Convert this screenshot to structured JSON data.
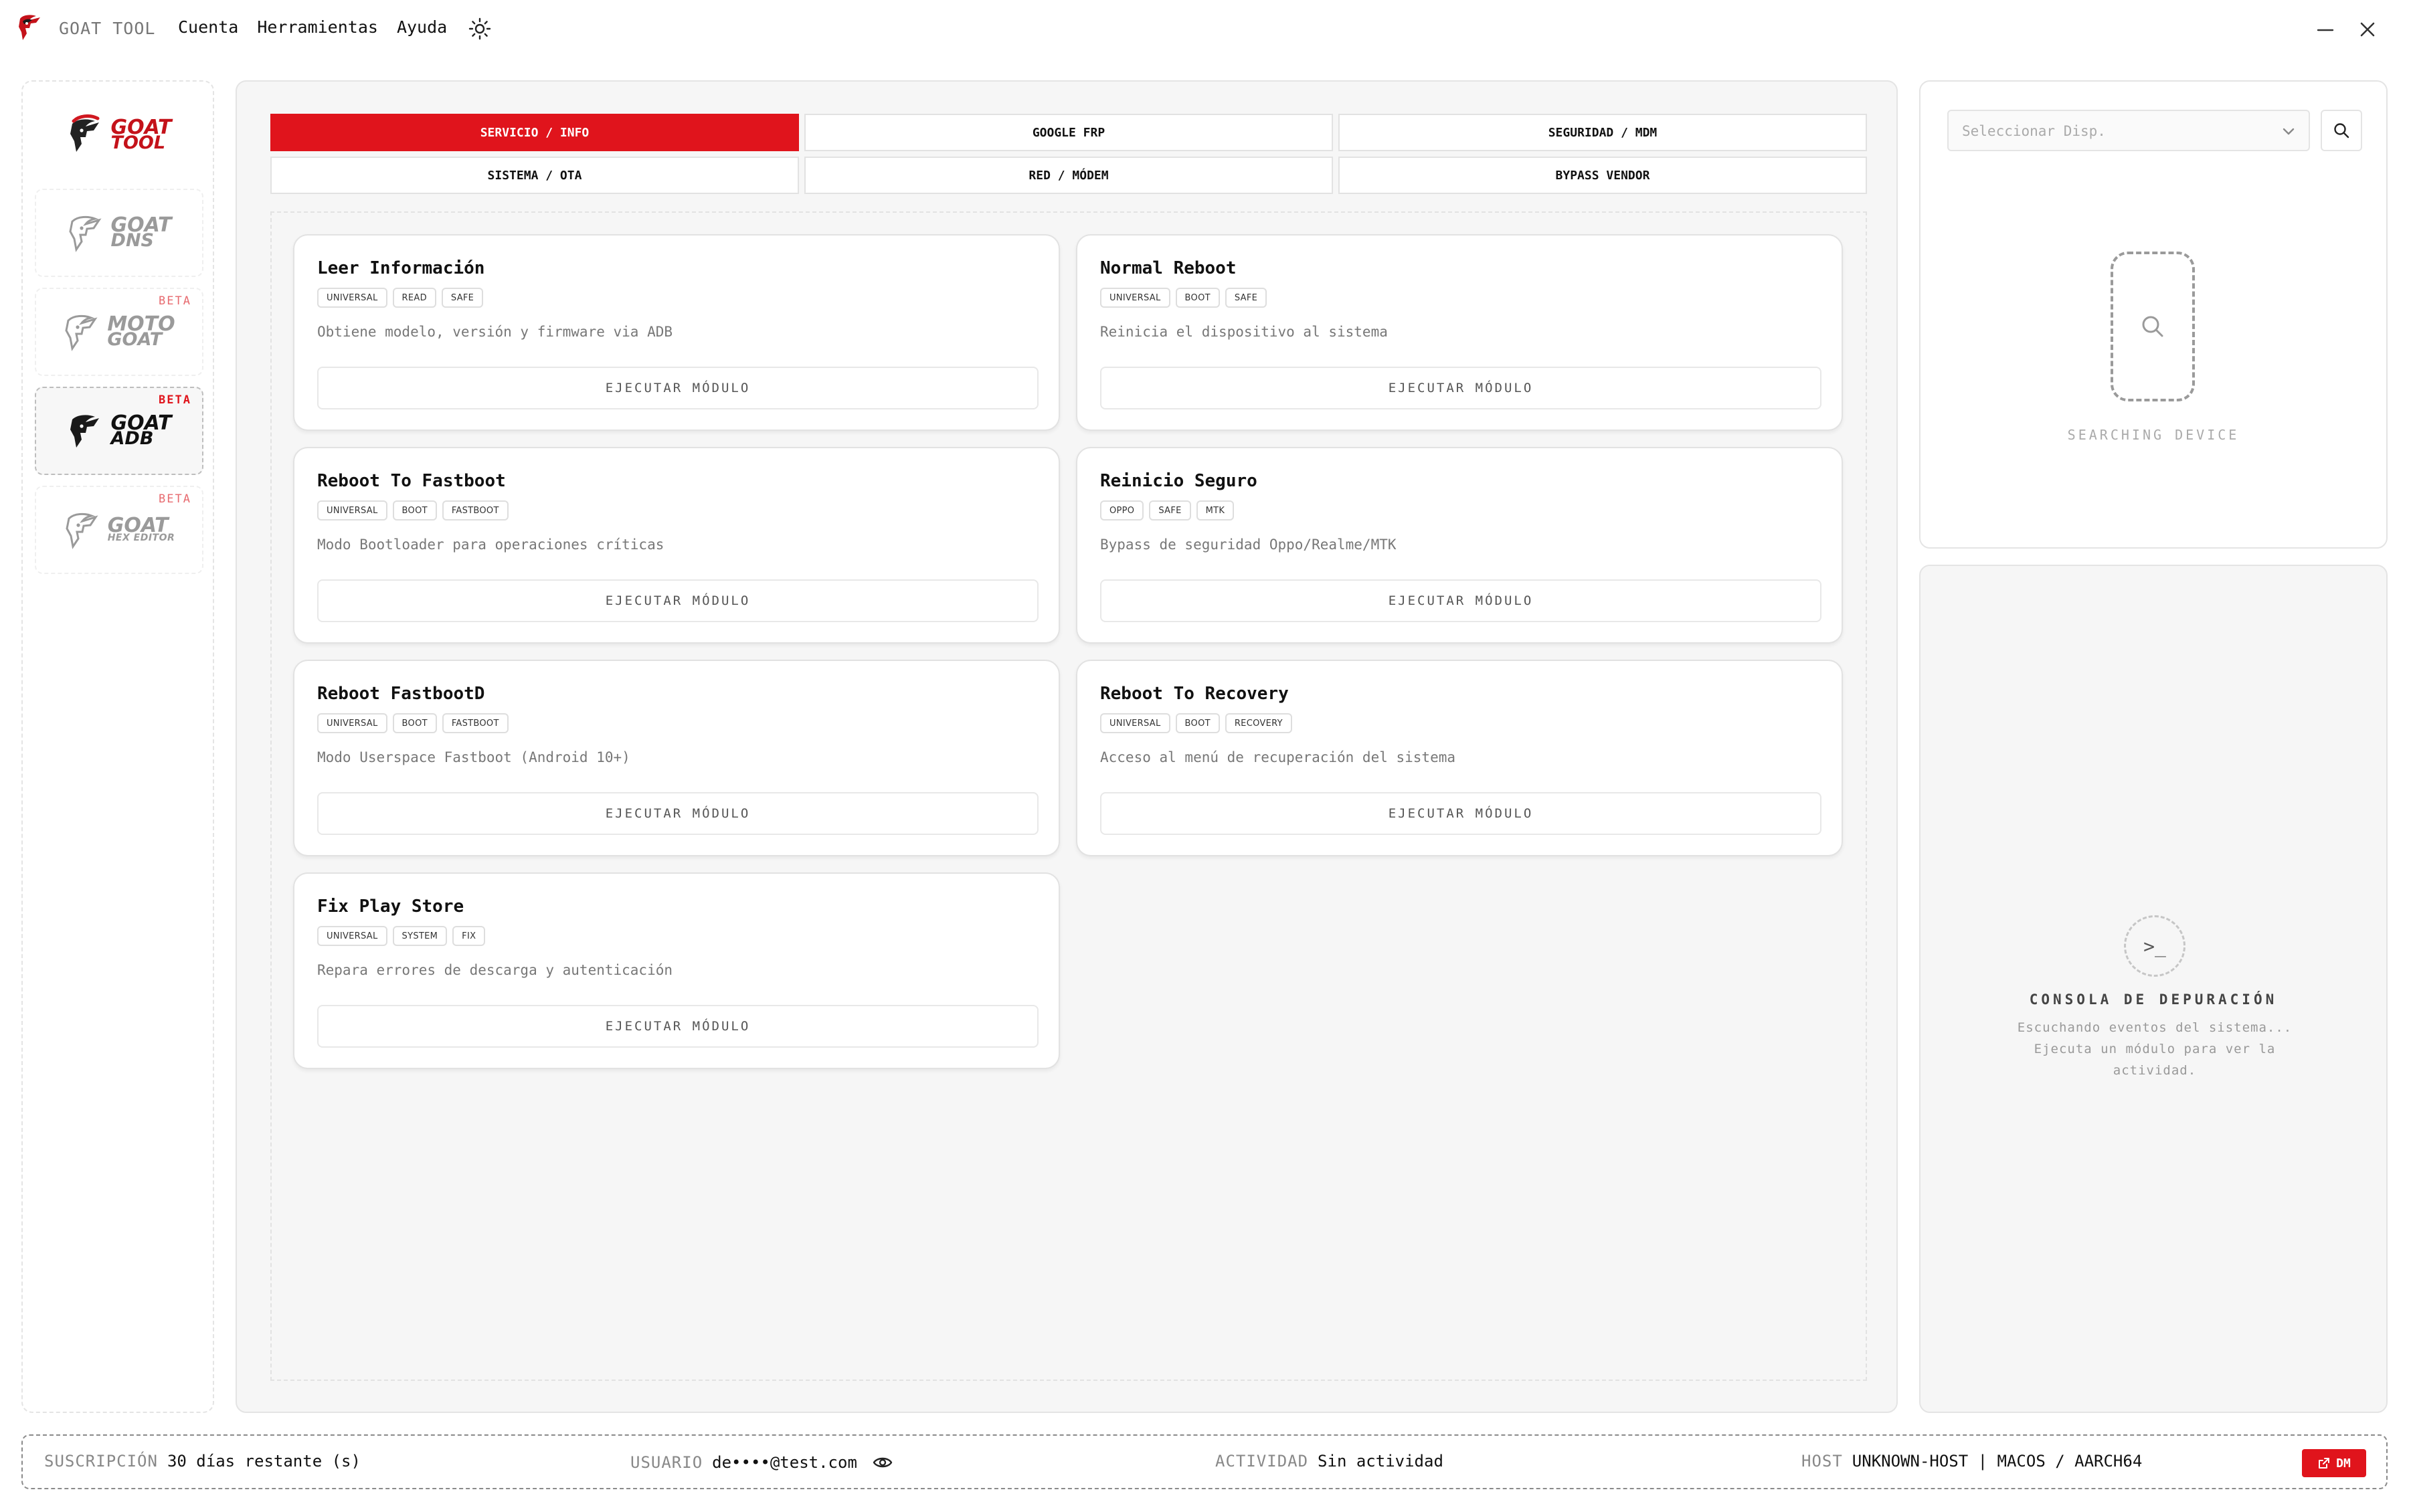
{
  "app": {
    "title": "GOAT TOOL",
    "menu": [
      "Cuenta",
      "Herramientas",
      "Ayuda"
    ]
  },
  "rail": {
    "items": [
      {
        "line1": "GOAT",
        "line2": "TOOL",
        "beta": ""
      },
      {
        "line1": "GOAT",
        "line2": "DNS",
        "beta": ""
      },
      {
        "line1": "MOTO",
        "line2": "GOAT",
        "beta": "BETA"
      },
      {
        "line1": "GOAT",
        "line2": "ADB",
        "beta": "BETA"
      },
      {
        "line1": "GOAT",
        "line2": "HEX EDITOR",
        "beta": "BETA"
      }
    ]
  },
  "tabs": [
    "SERVICIO / INFO",
    "GOOGLE FRP",
    "SEGURIDAD / MDM",
    "SISTEMA / OTA",
    "RED / MÓDEM",
    "BYPASS VENDOR"
  ],
  "run_label": "EJECUTAR MÓDULO",
  "modules": [
    {
      "title": "Leer Información",
      "tags": [
        "UNIVERSAL",
        "READ",
        "SAFE"
      ],
      "desc": "Obtiene modelo, versión y firmware via ADB"
    },
    {
      "title": "Normal Reboot",
      "tags": [
        "UNIVERSAL",
        "BOOT",
        "SAFE"
      ],
      "desc": "Reinicia el dispositivo al sistema"
    },
    {
      "title": "Reboot To Fastboot",
      "tags": [
        "UNIVERSAL",
        "BOOT",
        "FASTBOOT"
      ],
      "desc": "Modo Bootloader para operaciones críticas"
    },
    {
      "title": "Reinicio Seguro",
      "tags": [
        "OPPO",
        "SAFE",
        "MTK"
      ],
      "desc": "Bypass de seguridad Oppo/Realme/MTK"
    },
    {
      "title": "Reboot FastbootD",
      "tags": [
        "UNIVERSAL",
        "BOOT",
        "FASTBOOT"
      ],
      "desc": "Modo Userspace Fastboot (Android 10+)"
    },
    {
      "title": "Reboot To Recovery",
      "tags": [
        "UNIVERSAL",
        "BOOT",
        "RECOVERY"
      ],
      "desc": "Acceso al menú de recuperación del sistema"
    },
    {
      "title": "Fix Play Store",
      "tags": [
        "UNIVERSAL",
        "SYSTEM",
        "FIX"
      ],
      "desc": "Repara errores de descarga y autenticación"
    }
  ],
  "device": {
    "placeholder": "Seleccionar Disp.",
    "status": "SEARCHING DEVICE"
  },
  "console": {
    "icon": ">_",
    "title": "CONSOLA DE DEPURACIÓN",
    "line1": "Escuchando eventos del sistema...",
    "line2": "Ejecuta un módulo para ver la",
    "line3": "actividad."
  },
  "status": {
    "subscription_label": "SUSCRIPCIÓN",
    "subscription_value": "30 días restante (s)",
    "user_label": "USUARIO",
    "user_value": "de••••@test.com",
    "activity_label": "ACTIVIDAD",
    "activity_value": "Sin actividad",
    "host_label": "HOST",
    "host_value": "UNKNOWN-HOST | MACOS / AARCH64",
    "dm_label": "DM"
  },
  "colors": {
    "accent": "#e0141c",
    "beta": "#e0161d"
  }
}
